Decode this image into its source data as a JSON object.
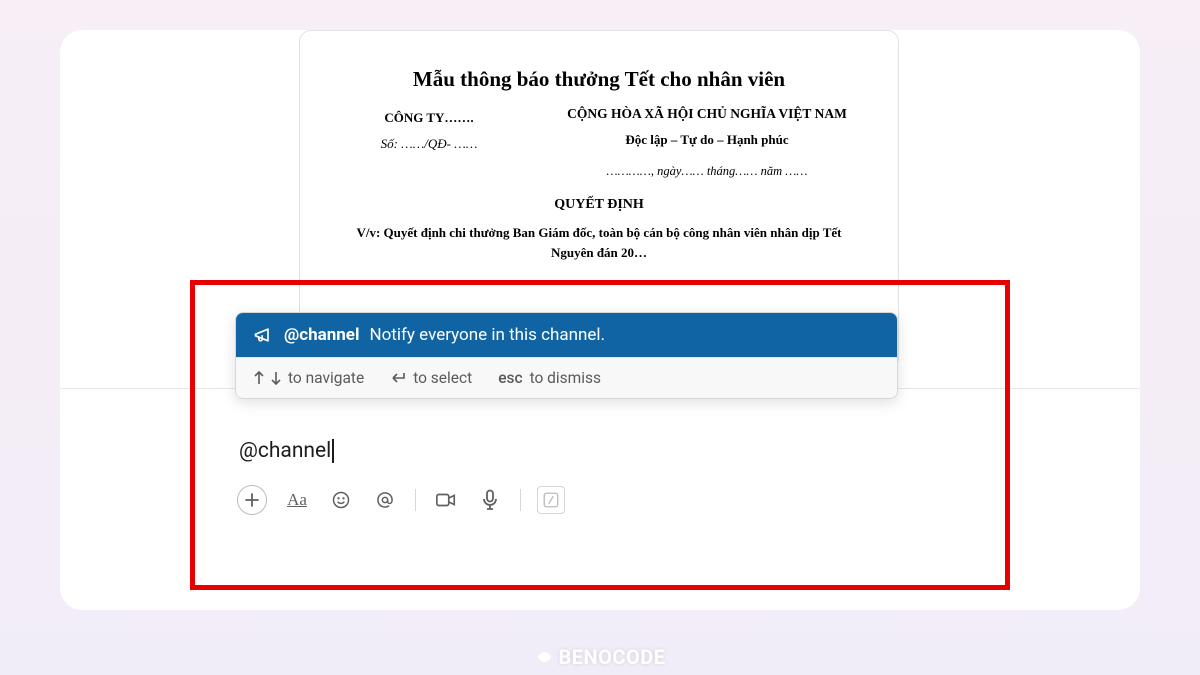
{
  "document": {
    "title": "Mẫu thông báo thưởng Tết cho nhân viên",
    "company_label": "CÔNG TY…….",
    "so_label": "Số: ……/QĐ- ……",
    "country": "CỘNG HÒA XÃ HỘI CHỦ NGHĨA VIỆT NAM",
    "motto": "Độc lập – Tự do – Hạnh phúc",
    "date_line": "…………, ngày…… tháng…… năm ……",
    "decision": "QUYẾT ĐỊNH",
    "subject": "V/v: Quyết định chi thưởng Ban Giám đốc, toàn bộ cán bộ công nhân viên nhân dịp Tết Nguyên đán 20…"
  },
  "autocomplete": {
    "option": {
      "mention": "@channel",
      "description": "Notify everyone in this channel."
    },
    "hints": {
      "navigate": "to navigate",
      "select": "to select",
      "dismiss_key": "esc",
      "dismiss": "to dismiss"
    }
  },
  "composer": {
    "input_value": "@channel"
  },
  "brand": "BENOCODE"
}
